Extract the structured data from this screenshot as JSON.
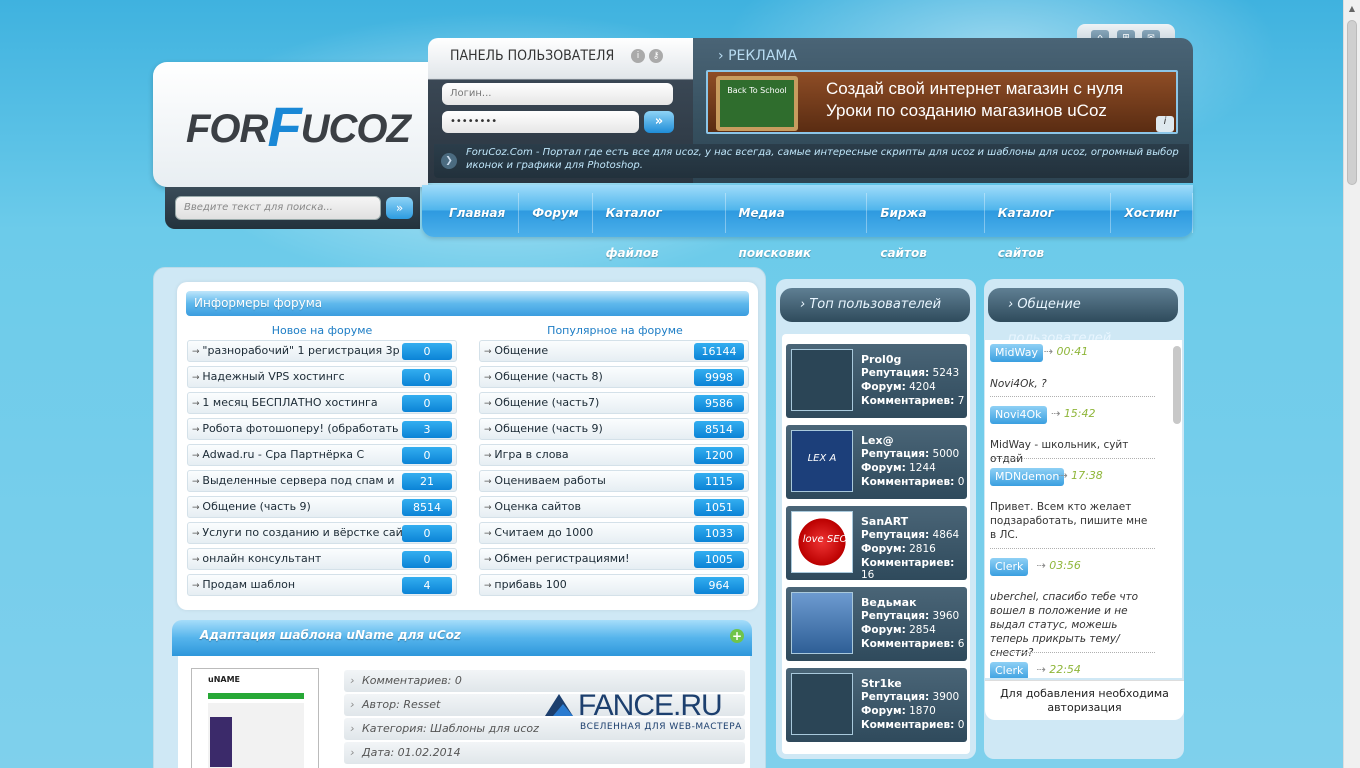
{
  "logo": {
    "left": "FOR",
    "mid": "F",
    "right": "UCOZ"
  },
  "search": {
    "placeholder": "Введите текст для поиска...",
    "button": "»"
  },
  "user_panel": {
    "title": "ПАНЕЛЬ ПОЛЬЗОВАТЕЛЯ",
    "login_placeholder": "Логин...",
    "password_value": "••••••••",
    "submit": "»"
  },
  "ad": {
    "title": "РЕКЛАМА",
    "board_text": "Back To School",
    "line1": "Создай свой интернет магазин с нуля",
    "line2": "Уроки по созданию магазинов uCoz",
    "info": "i"
  },
  "ticker": "ForuCoz.Com - Портал где есть все для ucoz, у нас всегда, самые интересные скрипты для ucoz и шаблоны для ucoz, огромный выбор иконок и графики для Photoshop.",
  "nav": [
    "Главная",
    "Форум",
    "Каталог файлов",
    "Медиа поисковик",
    "Биржа сайтов",
    "Каталог сайтов",
    "Хостинг"
  ],
  "forum_informer": {
    "title": "Информеры форума",
    "new_heading": "Новое на форуме",
    "popular_heading": "Популярное на форуме",
    "new_items": [
      {
        "title": "\"разнорабочий\" 1 регистрация 3р",
        "count": "0"
      },
      {
        "title": "Надежный VPS хостингс",
        "count": "0"
      },
      {
        "title": "1 месяц БЕСПЛАТНО хостинга",
        "count": "0"
      },
      {
        "title": "Робота фотошоперу! (обработать",
        "count": "3"
      },
      {
        "title": "Adwad.ru - Cpa Партнёрка С",
        "count": "0"
      },
      {
        "title": "Выделенные сервера под спам и",
        "count": "21"
      },
      {
        "title": "Общение (часть 9)",
        "count": "8514"
      },
      {
        "title": "Услуги по созданию и вёрстке сайтов!",
        "count": "0"
      },
      {
        "title": "онлайн консультант",
        "count": "0"
      },
      {
        "title": "Продам шаблон",
        "count": "4"
      }
    ],
    "popular_items": [
      {
        "title": "Общение",
        "count": "16144"
      },
      {
        "title": "Общение (часть 8)",
        "count": "9998"
      },
      {
        "title": "Общение (часть7)",
        "count": "9586"
      },
      {
        "title": "Общение (часть 9)",
        "count": "8514"
      },
      {
        "title": "Игра в слова",
        "count": "1200"
      },
      {
        "title": "Оцениваем работы",
        "count": "1115"
      },
      {
        "title": "Оценка сайтов",
        "count": "1051"
      },
      {
        "title": "Считаем до 1000",
        "count": "1033"
      },
      {
        "title": "Обмен регистрациями!",
        "count": "1005"
      },
      {
        "title": "прибавь 100",
        "count": "964"
      }
    ]
  },
  "article": {
    "title": "Адаптация шаблона uName для uCoz",
    "thumb_label": "uNAME",
    "meta": [
      "Комментариев: 0",
      "Автор: Resset",
      "Категория: Шаблоны для ucoz",
      "Дата: 01.02.2014"
    ]
  },
  "watermark": {
    "main": "FANCE.RU",
    "sub": "ВСЕЛЕННАЯ ДЛЯ WEB-МАСТЕРА"
  },
  "top_users": {
    "title": "Топ пользователей",
    "labels": {
      "rep": "Репутация:",
      "forum": "Форум:",
      "comments": "Комментариев:"
    },
    "users": [
      {
        "name": "Prol0g",
        "rep": "5243",
        "forum": "4204",
        "comments": "7",
        "avatar_text": ""
      },
      {
        "name": "Lex@",
        "rep": "5000",
        "forum": "1244",
        "comments": "0",
        "avatar_text": "LEX A"
      },
      {
        "name": "SanART",
        "rep": "4864",
        "forum": "2816",
        "comments": "16",
        "avatar_text": "I love SEO"
      },
      {
        "name": "Ведьмак",
        "rep": "3960",
        "forum": "2854",
        "comments": "6",
        "avatar_text": ""
      },
      {
        "name": "Str1ke",
        "rep": "3900",
        "forum": "1870",
        "comments": "0",
        "avatar_text": ""
      }
    ]
  },
  "chat": {
    "title": "Общение пользователей",
    "entries": [
      {
        "nick": "MidWay",
        "time": "00:41",
        "msg": "Novi4Ok, ?"
      },
      {
        "nick": "Novi4Ok",
        "time": "15:42",
        "msg": "MidWay - школьник, суйт отдай"
      },
      {
        "nick": "MDNdemon",
        "time": "17:38",
        "msg": "Привет. Всем кто желает подзаработать, пишите мне в ЛС."
      },
      {
        "nick": "Clerk",
        "time": "03:56",
        "msg": "uberchel, спасибо тебе что вошел в положение и не выдал статус, можешь теперь прикрыть тему/снести?"
      },
      {
        "nick": "Clerk",
        "time": "22:54",
        "msg": ""
      }
    ],
    "footer": "Для добавления необходима авторизация"
  }
}
